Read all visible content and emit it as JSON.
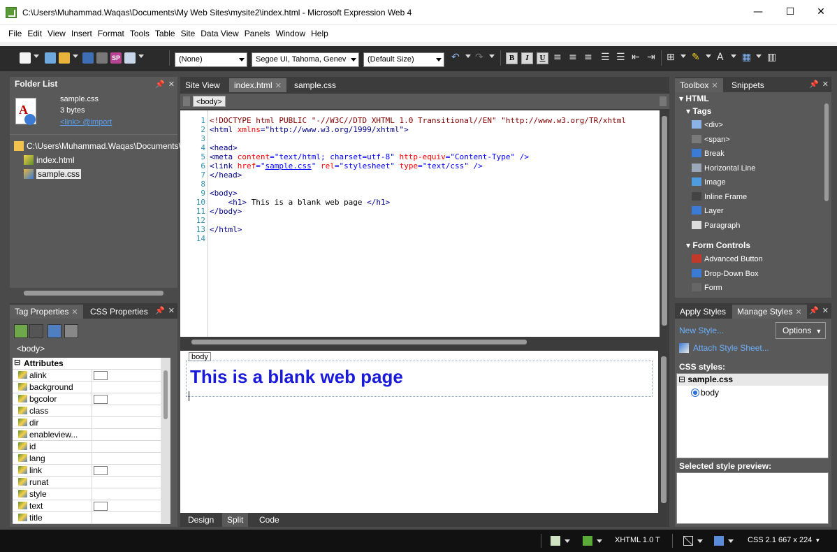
{
  "window": {
    "title": "C:\\Users\\Muhammad.Waqas\\Documents\\My Web Sites\\mysite2\\index.html - Microsoft Expression Web 4",
    "minimize": "—",
    "maximize": "☐",
    "close": "✕"
  },
  "menu": [
    "File",
    "Edit",
    "View",
    "Insert",
    "Format",
    "Tools",
    "Table",
    "Site",
    "Data View",
    "Panels",
    "Window",
    "Help"
  ],
  "toolbar": {
    "style_combo": "(None)",
    "font_combo": "Segoe UI, Tahoma, Genev",
    "size_combo": "(Default Size)",
    "bold": "B",
    "italic": "I",
    "underline": "U"
  },
  "folder_list": {
    "tab": "Folder List",
    "file_name": "sample.css",
    "file_size": "3 bytes",
    "file_links": "<link> @import",
    "root_path": "C:\\Users\\Muhammad.Waqas\\Documents\\M",
    "files": [
      "index.html",
      "sample.css"
    ]
  },
  "tag_properties": {
    "tab1": "Tag Properties",
    "tab2": "CSS Properties",
    "current_tag": "<body>",
    "section": "Attributes",
    "attributes": [
      {
        "name": "alink",
        "box": true
      },
      {
        "name": "background",
        "box": false
      },
      {
        "name": "bgcolor",
        "box": true
      },
      {
        "name": "class",
        "box": false
      },
      {
        "name": "dir",
        "box": false
      },
      {
        "name": "enableview...",
        "box": false
      },
      {
        "name": "id",
        "box": false
      },
      {
        "name": "lang",
        "box": false
      },
      {
        "name": "link",
        "box": true
      },
      {
        "name": "runat",
        "box": false
      },
      {
        "name": "style",
        "box": false
      },
      {
        "name": "text",
        "box": true
      },
      {
        "name": "title",
        "box": false
      }
    ]
  },
  "editor": {
    "tabs": [
      "Site View",
      "index.html",
      "sample.css"
    ],
    "breadcrumb": "<body>",
    "code_lines": [
      "1",
      "2",
      "3",
      "4",
      "5",
      "6",
      "7",
      "8",
      "9",
      "10",
      "11",
      "12",
      "13",
      "14"
    ],
    "code": {
      "l1": "<!DOCTYPE html PUBLIC \"-//W3C//DTD XHTML 1.0 Transitional//EN\" \"http://www.w3.org/TR/xhtml",
      "l2a": "<html ",
      "l2b": "xmlns",
      "l2c": "=\"http://www.w3.org/1999/xhtml\">",
      "l4": "<head>",
      "l5a": "<meta ",
      "l5b": "content",
      "l5c": "=\"text/html; charset=utf-8\" ",
      "l5d": "http-equiv",
      "l5e": "=\"Content-Type\" />",
      "l6a": "<link ",
      "l6b": "href",
      "l6c": "=\"",
      "l6d": "sample.css",
      "l6e": "\" ",
      "l6f": "rel",
      "l6g": "=\"stylesheet\" ",
      "l6h": "type",
      "l6i": "=\"text/css\" />",
      "l7": "</head>",
      "l9": "<body>",
      "l10a": "    <h1>",
      "l10b": " This is a blank web page ",
      "l10c": "</h1>",
      "l11": "</body>",
      "l13": "</html>"
    },
    "design_tag": "body",
    "design_heading": "This is a blank web page",
    "view_tabs": [
      "Design",
      "Split",
      "Code"
    ]
  },
  "toolbox": {
    "tab1": "Toolbox",
    "tab2": "Snippets",
    "html_header": "HTML",
    "tags_header": "Tags",
    "tags": [
      "<div>",
      "<span>",
      "Break",
      "Horizontal Line",
      "Image",
      "Inline Frame",
      "Layer",
      "Paragraph"
    ],
    "form_header": "Form Controls",
    "form_items": [
      "Advanced Button",
      "Drop-Down Box",
      "Form"
    ]
  },
  "styles": {
    "tab1": "Apply Styles",
    "tab2": "Manage Styles",
    "new_style": "New Style...",
    "options": "Options",
    "attach": "Attach Style Sheet...",
    "css_styles_label": "CSS styles:",
    "sheet": "sample.css",
    "rule": "body",
    "preview_label": "Selected style preview:"
  },
  "statusbar": {
    "doctype": "XHTML 1.0 T",
    "css": "CSS 2.1",
    "size": "667 x 224"
  }
}
